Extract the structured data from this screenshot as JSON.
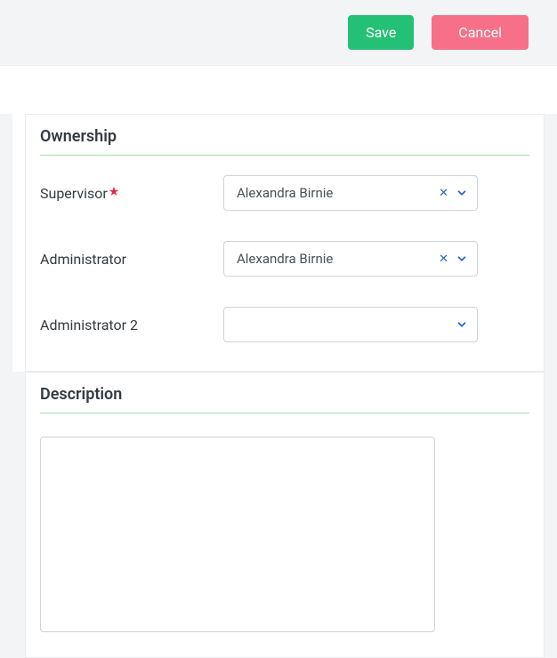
{
  "header": {
    "save_label": "Save",
    "cancel_label": "Cancel"
  },
  "ownership": {
    "section_title": "Ownership",
    "fields": {
      "supervisor": {
        "label": "Supervisor",
        "required": true,
        "value": "Alexandra Birnie"
      },
      "administrator": {
        "label": "Administrator",
        "required": false,
        "value": "Alexandra Birnie"
      },
      "administrator2": {
        "label": "Administrator 2",
        "required": false,
        "value": ""
      }
    }
  },
  "description": {
    "section_title": "Description",
    "value": ""
  },
  "colors": {
    "save": "#24c075",
    "cancel": "#f6708a",
    "accent": "#2765d1",
    "divider": "#9fe0a8",
    "required": "#e8254d"
  }
}
